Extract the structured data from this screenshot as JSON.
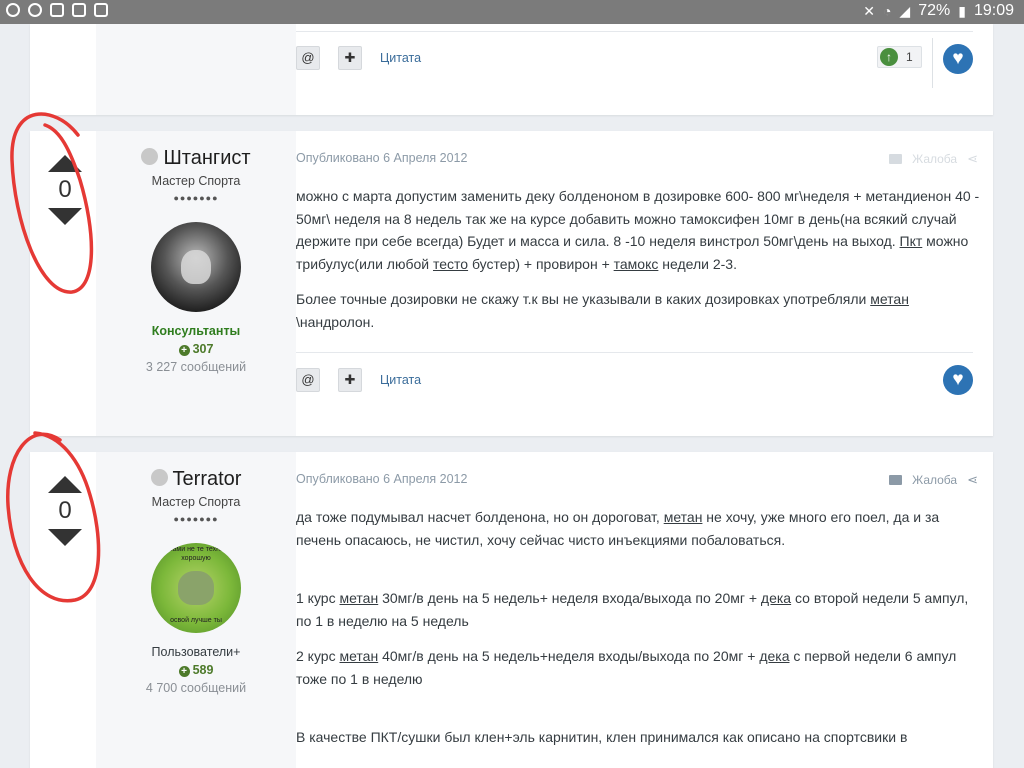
{
  "statusbar": {
    "battery": "72%",
    "time": "19:09"
  },
  "prev_post": {
    "quote_label": "Цитата",
    "reaction_count": "1"
  },
  "posts": [
    {
      "vote": "0",
      "username": "Штангист",
      "rank": "Мастер Спорта",
      "pips": "●●●●●●●",
      "group": "Консультанты",
      "group_color": "#2f7d1e",
      "reputation": "307",
      "post_count": "3 227 сообщений",
      "published": "Опубликовано 6 Апреля 2012",
      "report_label": "Жалоба",
      "paragraphs": [
        "можно с марта допустим заменить деку болденоном в дозировке 600- 800 мг\\неделя + метандиенон 40 - 50мг\\ неделя на 8 недель так же на курсе добавить можно тамоксифен 10мг в день(на всякий случай держите при себе всегда) Будет и масса и сила. 8 -10 неделя винстрол 50мг\\день на выход. Пкт можно трибулус(или любой тесто бустер) + провирон + тамокс недели 2-3.",
        "Более точные дозировки не скажу т.к вы не указывали в каких дозировках употребляли метан \\нандролон."
      ],
      "quote_label": "Цитата"
    },
    {
      "vote": "0",
      "username": "Terrator",
      "rank": "Мастер Спорта",
      "pips": "●●●●●●●",
      "avatar_text_top": "весами не те технику хорошую",
      "avatar_text_bottom": "освой лучше ты",
      "group": "Пользователи+",
      "group_color": "#353c41",
      "reputation": "589",
      "post_count": "4 700 сообщений",
      "published": "Опубликовано 6 Апреля 2012",
      "report_label": "Жалоба",
      "paragraphs": [
        "да тоже подумывал насчет болденона, но он дороговат, метан не хочу, уже много его поел, да и за печень опасаюсь, не чистил, хочу сейчас чисто инъекциями побаловаться.",
        "1 курс метан 30мг/в день на 5 недель+ неделя входа/выхода по 20мг + дека со второй недели 5 ампул, по 1 в неделю на 5 недель",
        "2 курс метан 40мг/в день на 5 недель+неделя входы/выхода по 20мг + дека с первой недели 6 ампул тоже по 1 в неделю",
        "В качестве ПКТ/сушки был клен+эль карнитин, клен принимался как описано на спортсвики в"
      ]
    }
  ]
}
